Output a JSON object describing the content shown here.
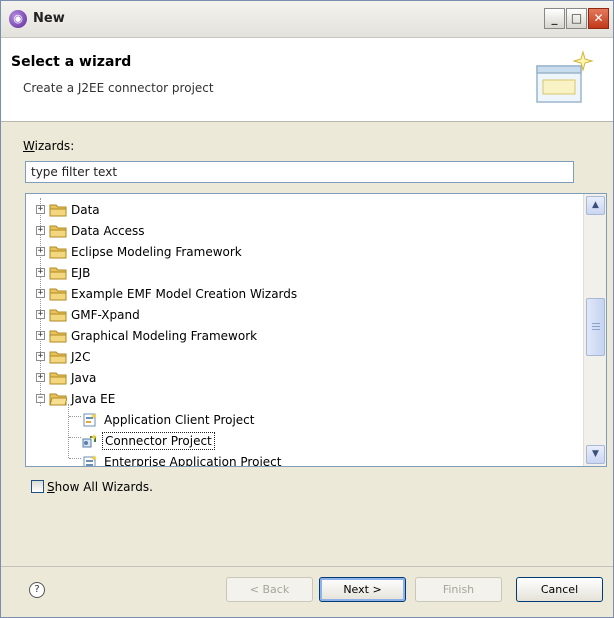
{
  "window": {
    "title": "New",
    "minimize_glyph": "_",
    "maximize_glyph": "□",
    "close_glyph": "✕"
  },
  "banner": {
    "title": "Select a wizard",
    "description": "Create a J2EE connector project"
  },
  "wizards_label": {
    "mnemonic": "W",
    "rest": "izards:"
  },
  "filter": {
    "value": "type filter text"
  },
  "tree": {
    "items": [
      {
        "label": "Data",
        "type": "folder",
        "expanded": false
      },
      {
        "label": "Data Access",
        "type": "folder",
        "expanded": false
      },
      {
        "label": "Eclipse Modeling Framework",
        "type": "folder",
        "expanded": false
      },
      {
        "label": "EJB",
        "type": "folder",
        "expanded": false
      },
      {
        "label": "Example EMF Model Creation Wizards",
        "type": "folder",
        "expanded": false
      },
      {
        "label": "GMF-Xpand",
        "type": "folder",
        "expanded": false
      },
      {
        "label": "Graphical Modeling Framework",
        "type": "folder",
        "expanded": false
      },
      {
        "label": "J2C",
        "type": "folder",
        "expanded": false
      },
      {
        "label": "Java",
        "type": "folder",
        "expanded": false
      },
      {
        "label": "Java EE",
        "type": "folder",
        "expanded": true
      },
      {
        "label": "Application Client Project",
        "type": "item",
        "selected": false
      },
      {
        "label": "Connector Project",
        "type": "item",
        "selected": true
      },
      {
        "label": "Enterprise Application Project",
        "type": "item",
        "selected": false
      }
    ]
  },
  "show_all": {
    "mnemonic": "S",
    "rest": "how All Wizards.",
    "checked": false
  },
  "buttons": {
    "help": "?",
    "back": "< Back",
    "next": "Next >",
    "finish": "Finish",
    "cancel": "Cancel"
  },
  "colors": {
    "selection_border": "#222222",
    "folder": "#e8c25a",
    "window_bg": "#ece9d8"
  }
}
